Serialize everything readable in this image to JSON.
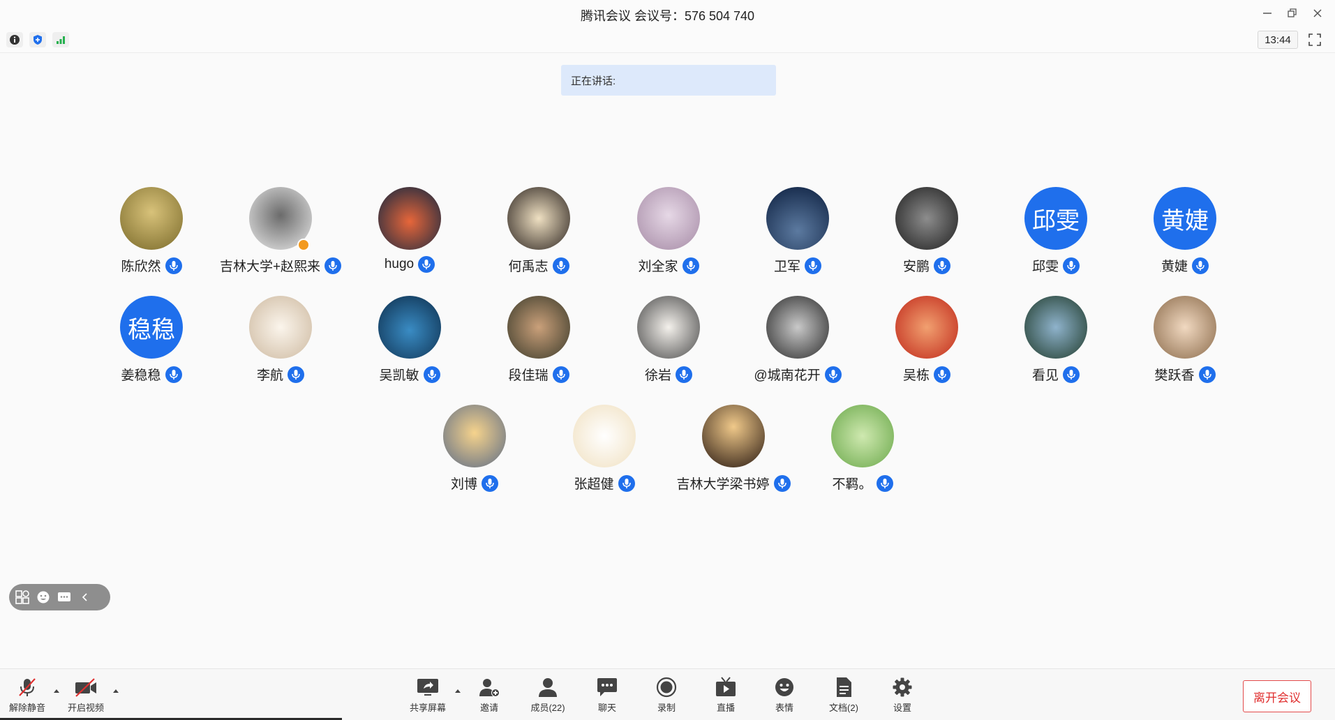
{
  "window": {
    "title": "腾讯会议 会议号：576 504 740"
  },
  "topbar": {
    "time": "13:44"
  },
  "speaking": {
    "label": "正在讲话:"
  },
  "participants": [
    {
      "name": "陈欣然",
      "avatar_kind": "photo"
    },
    {
      "name": "吉林大学+赵熙来",
      "avatar_kind": "photo"
    },
    {
      "name": "hugo",
      "avatar_kind": "photo"
    },
    {
      "name": "何禹志",
      "avatar_kind": "photo"
    },
    {
      "name": "刘全家",
      "avatar_kind": "photo"
    },
    {
      "name": "卫军",
      "avatar_kind": "photo"
    },
    {
      "name": "安鹏",
      "avatar_kind": "photo"
    },
    {
      "name": "邱雯",
      "avatar_kind": "text",
      "avatar_text": "邱雯"
    },
    {
      "name": "黄婕",
      "avatar_kind": "text",
      "avatar_text": "黄婕"
    },
    {
      "name": "姜稳稳",
      "avatar_kind": "text",
      "avatar_text": "稳稳"
    },
    {
      "name": "李航",
      "avatar_kind": "photo"
    },
    {
      "name": "吴凯敏",
      "avatar_kind": "photo"
    },
    {
      "name": "段佳瑞",
      "avatar_kind": "photo"
    },
    {
      "name": "徐岩",
      "avatar_kind": "photo"
    },
    {
      "name": "@城南花开",
      "avatar_kind": "photo"
    },
    {
      "name": "吴栋",
      "avatar_kind": "photo"
    },
    {
      "name": "看见",
      "avatar_kind": "photo"
    },
    {
      "name": "樊跃香",
      "avatar_kind": "photo"
    },
    {
      "name": "刘博",
      "avatar_kind": "photo"
    },
    {
      "name": "张超健",
      "avatar_kind": "photo"
    },
    {
      "name": "吉林大学梁书婷",
      "avatar_kind": "photo"
    },
    {
      "name": "不羁。",
      "avatar_kind": "photo"
    }
  ],
  "toolbar": {
    "unmute": "解除静音",
    "start_video": "开启视频",
    "share_screen": "共享屏幕",
    "invite": "邀请",
    "members": "成员(22)",
    "chat": "聊天",
    "record": "录制",
    "live": "直播",
    "reactions": "表情",
    "documents": "文档(2)",
    "settings": "设置",
    "leave": "离开会议"
  },
  "colors": {
    "accent": "#1f6fec",
    "leave_red": "#e03030",
    "speaking_bg": "#dde9fb"
  },
  "icons": [
    "info-icon",
    "shield-icon",
    "signal-icon",
    "fullscreen-icon",
    "mic-muted-icon",
    "video-off-icon",
    "share-screen-icon",
    "invite-icon",
    "members-icon",
    "chat-icon",
    "record-icon",
    "live-icon",
    "emoji-icon",
    "document-icon",
    "gear-icon"
  ]
}
